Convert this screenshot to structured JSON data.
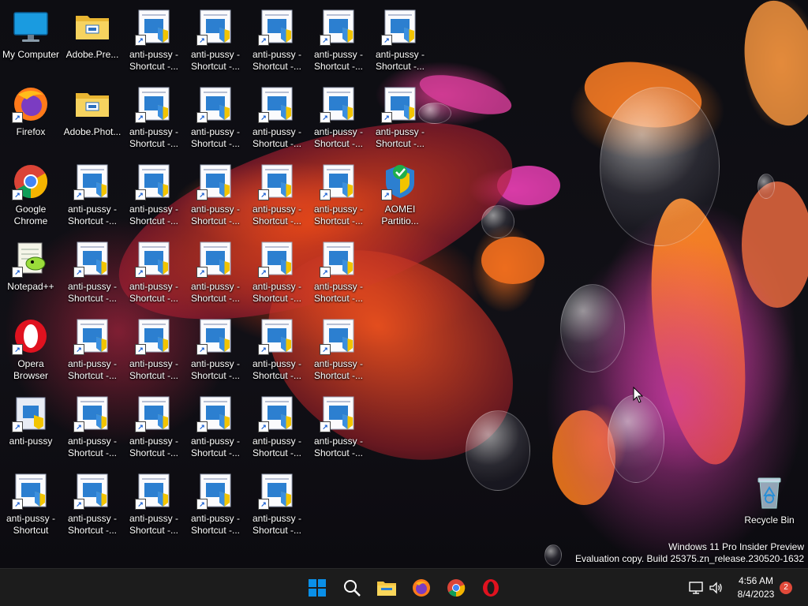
{
  "desktop": {
    "shortcut_label": "anti-pussy - Shortcut -...",
    "columns": [
      {
        "items": [
          {
            "label": "My Computer",
            "icon": "monitor-icon"
          },
          {
            "label": "Firefox",
            "icon": "firefox-icon"
          },
          {
            "label": "Google Chrome",
            "icon": "chrome-icon"
          },
          {
            "label": "Notepad++",
            "icon": "notepadpp-icon"
          },
          {
            "label": "Opera Browser",
            "icon": "opera-icon"
          },
          {
            "label": "anti-pussy",
            "icon": "anti-pussy-icon"
          },
          {
            "label": "anti-pussy - Shortcut",
            "icon": "shortcut-icon"
          }
        ]
      },
      {
        "items": [
          {
            "label": "Adobe.Pre...",
            "icon": "folder-icon"
          },
          {
            "label": "Adobe.Phot...",
            "icon": "folder-icon"
          },
          {
            "label": "anti-pussy - Shortcut -...",
            "icon": "shortcut-icon"
          },
          {
            "label": "anti-pussy - Shortcut -...",
            "icon": "shortcut-icon"
          },
          {
            "label": "anti-pussy - Shortcut -...",
            "icon": "shortcut-icon"
          },
          {
            "label": "anti-pussy - Shortcut -...",
            "icon": "shortcut-icon"
          },
          {
            "label": "anti-pussy - Shortcut -...",
            "icon": "shortcut-icon"
          }
        ]
      },
      {
        "items": [
          {
            "label": "anti-pussy - Shortcut -...",
            "icon": "shortcut-icon"
          },
          {
            "label": "anti-pussy - Shortcut -...",
            "icon": "shortcut-icon"
          },
          {
            "label": "anti-pussy - Shortcut -...",
            "icon": "shortcut-icon"
          },
          {
            "label": "anti-pussy - Shortcut -...",
            "icon": "shortcut-icon"
          },
          {
            "label": "anti-pussy - Shortcut -...",
            "icon": "shortcut-icon"
          },
          {
            "label": "anti-pussy - Shortcut -...",
            "icon": "shortcut-icon"
          },
          {
            "label": "anti-pussy - Shortcut -...",
            "icon": "shortcut-icon"
          }
        ]
      },
      {
        "items": [
          {
            "label": "anti-pussy - Shortcut -...",
            "icon": "shortcut-icon"
          },
          {
            "label": "anti-pussy - Shortcut -...",
            "icon": "shortcut-icon"
          },
          {
            "label": "anti-pussy - Shortcut -...",
            "icon": "shortcut-icon"
          },
          {
            "label": "anti-pussy - Shortcut -...",
            "icon": "shortcut-icon"
          },
          {
            "label": "anti-pussy - Shortcut -...",
            "icon": "shortcut-icon"
          },
          {
            "label": "anti-pussy - Shortcut -...",
            "icon": "shortcut-icon"
          },
          {
            "label": "anti-pussy - Shortcut -...",
            "icon": "shortcut-icon"
          }
        ]
      },
      {
        "items": [
          {
            "label": "anti-pussy - Shortcut -...",
            "icon": "shortcut-icon"
          },
          {
            "label": "anti-pussy - Shortcut -...",
            "icon": "shortcut-icon"
          },
          {
            "label": "anti-pussy - Shortcut -...",
            "icon": "shortcut-icon"
          },
          {
            "label": "anti-pussy - Shortcut -...",
            "icon": "shortcut-icon"
          },
          {
            "label": "anti-pussy - Shortcut -...",
            "icon": "shortcut-icon"
          },
          {
            "label": "anti-pussy - Shortcut -...",
            "icon": "shortcut-icon"
          },
          {
            "label": "anti-pussy - Shortcut -...",
            "icon": "shortcut-icon"
          }
        ]
      },
      {
        "items": [
          {
            "label": "anti-pussy - Shortcut -...",
            "icon": "shortcut-icon"
          },
          {
            "label": "anti-pussy - Shortcut -...",
            "icon": "shortcut-icon"
          },
          {
            "label": "anti-pussy - Shortcut -...",
            "icon": "shortcut-icon"
          },
          {
            "label": "anti-pussy - Shortcut -...",
            "icon": "shortcut-icon"
          },
          {
            "label": "anti-pussy - Shortcut -...",
            "icon": "shortcut-icon"
          },
          {
            "label": "anti-pussy - Shortcut -...",
            "icon": "shortcut-icon"
          }
        ]
      },
      {
        "items": [
          {
            "label": "anti-pussy - Shortcut -...",
            "icon": "shortcut-icon"
          },
          {
            "label": "anti-pussy - Shortcut -...",
            "icon": "shortcut-icon"
          },
          {
            "label": "AOMEI Partitio...",
            "icon": "aomei-icon"
          }
        ]
      }
    ],
    "recycle_bin": {
      "label": "Recycle Bin",
      "icon": "recycle-bin-icon"
    }
  },
  "watermark": {
    "line1": "Windows 11 Pro Insider Preview",
    "line2": "Evaluation copy. Build 25375.zn_release.230520-1632"
  },
  "taskbar": {
    "apps": [
      {
        "name": "start",
        "icon": "windows-start-icon"
      },
      {
        "name": "search",
        "icon": "search-icon"
      },
      {
        "name": "file-explorer",
        "icon": "file-explorer-icon"
      },
      {
        "name": "firefox",
        "icon": "firefox-icon"
      },
      {
        "name": "chrome",
        "icon": "chrome-icon"
      },
      {
        "name": "opera",
        "icon": "opera-icon"
      }
    ],
    "tray": {
      "time": "4:56 AM",
      "date": "8/4/2023",
      "notification_count": "2",
      "network_icon": "network-icon",
      "volume_icon": "volume-icon"
    }
  },
  "colors": {
    "taskbar": "#1c1c1c",
    "accent": "#0078d4",
    "badge": "#e04a3a"
  }
}
